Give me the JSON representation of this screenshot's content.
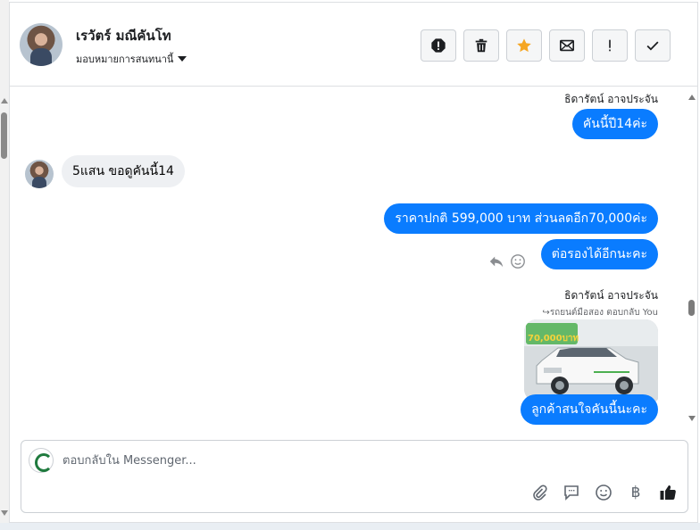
{
  "header": {
    "contact_name": "เรวัตร์ มณีคันโท",
    "assign_label": "มอบหมายการสนทนานี้"
  },
  "messages": [
    {
      "type": "sender",
      "text": "ธิดารัตน์ อาจประจัน"
    },
    {
      "type": "outgoing",
      "text": "คันนี้ปี14ค่ะ"
    },
    {
      "type": "incoming",
      "text": "5แสน ขอดูคันนี้14"
    },
    {
      "type": "outgoing",
      "text": "ราคาปกติ 599,000 บาท ส่วนลดอีก70,000ค่ะ"
    },
    {
      "type": "outgoing",
      "text": "ต่อรองได้อีกนะคะ"
    },
    {
      "type": "sender",
      "text": "ธิดารัตน์ อาจประจัน"
    },
    {
      "type": "reply_note",
      "text": "รถยนต์มือสอง ตอบกลับ You"
    },
    {
      "type": "image",
      "text": "70,000บาท"
    },
    {
      "type": "outgoing",
      "text": "ลูกค้าสนใจคันนี้นะคะ"
    }
  ],
  "composer": {
    "placeholder": "ตอบกลับใน Messenger..."
  },
  "icons": {
    "actions": [
      "alert-icon",
      "trash-icon",
      "star-icon",
      "envelope-icon",
      "exclamation-icon",
      "check-icon"
    ],
    "composer": [
      "paperclip-icon",
      "chat-bubble-icon",
      "emoji-icon",
      "baht-icon",
      "thumbs-up-icon"
    ],
    "baht_symbol": "฿"
  },
  "colors": {
    "accent": "#0a7cff",
    "star": "#f5a623",
    "incoming_bubble": "#eef0f3"
  }
}
